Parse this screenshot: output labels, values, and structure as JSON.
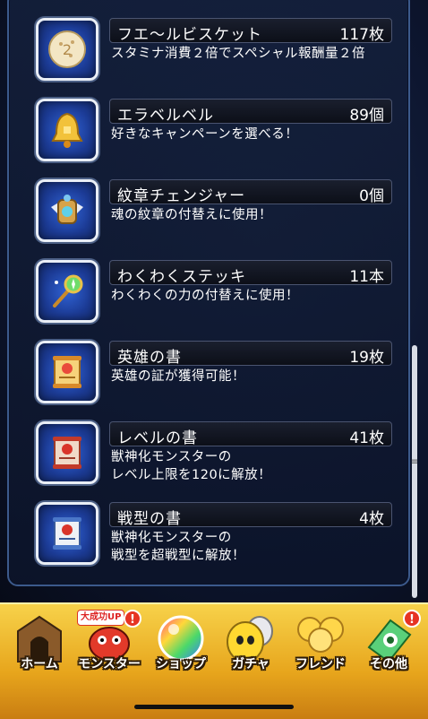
{
  "items": [
    {
      "name": "フエ〜ルビスケット",
      "count": "117枚",
      "desc": [
        "スタミナ消費２倍でスペシャル報酬量２倍"
      ],
      "icon": "biscuit-icon"
    },
    {
      "name": "エラベルベル",
      "count": "89個",
      "desc": [
        "好きなキャンペーンを選べる！"
      ],
      "icon": "bell-icon"
    },
    {
      "name": "紋章チェンジャー",
      "count": "0個",
      "desc": [
        "魂の紋章の付替えに使用！"
      ],
      "icon": "crest-changer-icon"
    },
    {
      "name": "わくわくステッキ",
      "count": "11本",
      "desc": [
        "わくわくの力の付替えに使用！"
      ],
      "icon": "magic-wand-icon"
    },
    {
      "name": "英雄の書",
      "count": "19枚",
      "desc": [
        "英雄の証が獲得可能！"
      ],
      "icon": "hero-scroll-icon"
    },
    {
      "name": "レベルの書",
      "count": "41枚",
      "desc": [
        "獣神化モンスターの",
        "レベル上限を120に解放！"
      ],
      "icon": "level-scroll-icon"
    },
    {
      "name": "戦型の書",
      "count": "4枚",
      "desc": [
        "獣神化モンスターの",
        "戦型を超戦型に解放！"
      ],
      "icon": "battle-type-scroll-icon"
    }
  ],
  "tabs": [
    {
      "label": "ホーム",
      "icon": "home-gate-icon"
    },
    {
      "label": "モンスター",
      "icon": "monster-icon",
      "promo": "大成功UP",
      "alert": "!"
    },
    {
      "label": "ショップ",
      "icon": "rainbow-orb-icon"
    },
    {
      "label": "ガチャ",
      "icon": "gacha-egg-icon"
    },
    {
      "label": "フレンド",
      "icon": "friend-balloons-icon"
    },
    {
      "label": "その他",
      "icon": "other-menu-icon",
      "alert": "!"
    }
  ],
  "colors": {
    "tabbar": "#f0bd33",
    "panel_border": "#3c5a8c",
    "icon_bg": "#2f62d4",
    "alert": "#e63323"
  }
}
